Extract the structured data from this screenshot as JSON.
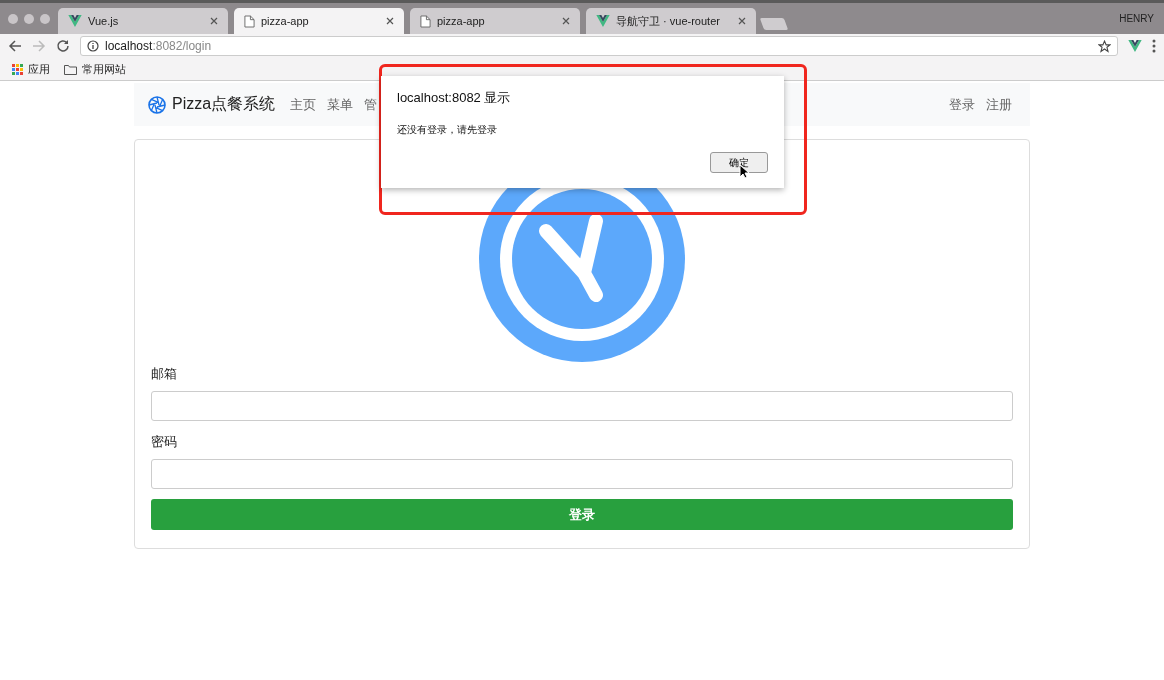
{
  "browser": {
    "tabs": [
      {
        "title": "Vue.js",
        "kind": "vue",
        "selected": false
      },
      {
        "title": "pizza-app",
        "kind": "page",
        "selected": true
      },
      {
        "title": "pizza-app",
        "kind": "page",
        "selected": false
      },
      {
        "title": "导航守卫 · vue-router",
        "kind": "vue",
        "selected": false
      }
    ],
    "user": "HENRY",
    "address": {
      "host": "localhost",
      "rest": ":8082/login"
    },
    "bookmarks": [
      {
        "label": "应用",
        "kind": "apps"
      },
      {
        "label": "常用网站",
        "kind": "folder"
      }
    ]
  },
  "navbar": {
    "brand": "Pizza点餐系统",
    "links": [
      "主页",
      "菜单",
      "管"
    ],
    "right_links": [
      "登录",
      "注册"
    ]
  },
  "form": {
    "fields": [
      {
        "label": "邮箱"
      },
      {
        "label": "密码"
      }
    ],
    "submit": "登录"
  },
  "dialog": {
    "title": "localhost:8082 显示",
    "message": "还没有登录，请先登录",
    "button": "确定"
  }
}
